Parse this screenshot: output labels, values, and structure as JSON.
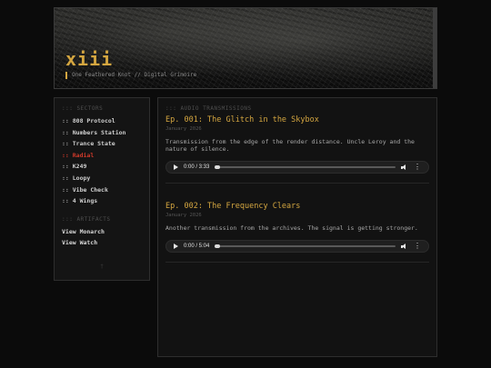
{
  "header": {
    "title": "xiii",
    "tagline": "One Feathered Knot // Digital Grimoire"
  },
  "sidebar": {
    "sectors_heading": "::: SECTORS",
    "items": [
      {
        "prefix": ":: ",
        "label": "808 Protocol",
        "active": false
      },
      {
        "prefix": ":: ",
        "label": "Numbers Station",
        "active": false
      },
      {
        "prefix": ":: ",
        "label": "Trance State",
        "active": false
      },
      {
        "prefix": ":: ",
        "label": "Radial",
        "active": true
      },
      {
        "prefix": ":: ",
        "label": "K249",
        "active": false
      },
      {
        "prefix": ":: ",
        "label": "Loopy",
        "active": false
      },
      {
        "prefix": ":: ",
        "label": "Vibe Check",
        "active": false
      },
      {
        "prefix": ":: ",
        "label": "4 Wings",
        "active": false
      }
    ],
    "artifacts_heading": "::: ARTIFACTS",
    "links": [
      {
        "label": "View Monarch"
      },
      {
        "label": "View Watch"
      }
    ],
    "footer_glyph": "†"
  },
  "main": {
    "heading": "::: AUDIO TRANSMISSIONS",
    "episodes": [
      {
        "title": "Ep. 001: The Glitch in the Skybox",
        "date": "January 2026",
        "description": "Transmission from the edge of the render distance. Uncle Leroy and the nature of silence.",
        "player": {
          "time": "0:00 / 3:33",
          "progress": 0
        }
      },
      {
        "title": "Ep. 002: The Frequency Clears",
        "date": "January 2026",
        "description": "Another transmission from the archives. The signal is getting stronger.",
        "player": {
          "time": "0:00 / 5:04",
          "progress": 0
        }
      }
    ]
  },
  "colors": {
    "accent": "#d4a640",
    "active": "#d13a2a",
    "background": "#0b0b0b"
  },
  "icons": {
    "play": "play-icon",
    "volume": "volume-icon",
    "more": "more-options-icon"
  }
}
